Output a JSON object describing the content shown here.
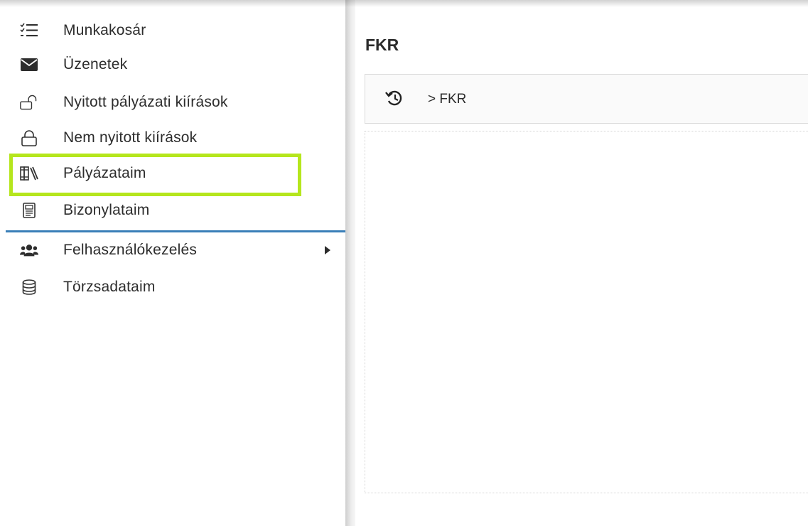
{
  "sidebar": {
    "items": [
      {
        "label": "Munkakosár",
        "icon": "checklist-icon"
      },
      {
        "label": "Üzenetek",
        "icon": "envelope-icon"
      },
      {
        "label": "Nyitott pályázati kiírások",
        "icon": "unlock-icon"
      },
      {
        "label": "Nem nyitott kiírások",
        "icon": "lock-icon"
      },
      {
        "label": "Pályázataim",
        "icon": "books-icon"
      },
      {
        "label": "Bizonylataim",
        "icon": "document-icon"
      },
      {
        "label": "Felhasználókezelés",
        "icon": "users-icon"
      },
      {
        "label": "Törzsadataim",
        "icon": "database-icon"
      }
    ],
    "highlight_color": "#b5e61d",
    "separator_color": "#3a7fb8"
  },
  "main": {
    "title": "FKR",
    "breadcrumb": {
      "icon": "history-icon",
      "text": "> FKR"
    }
  }
}
